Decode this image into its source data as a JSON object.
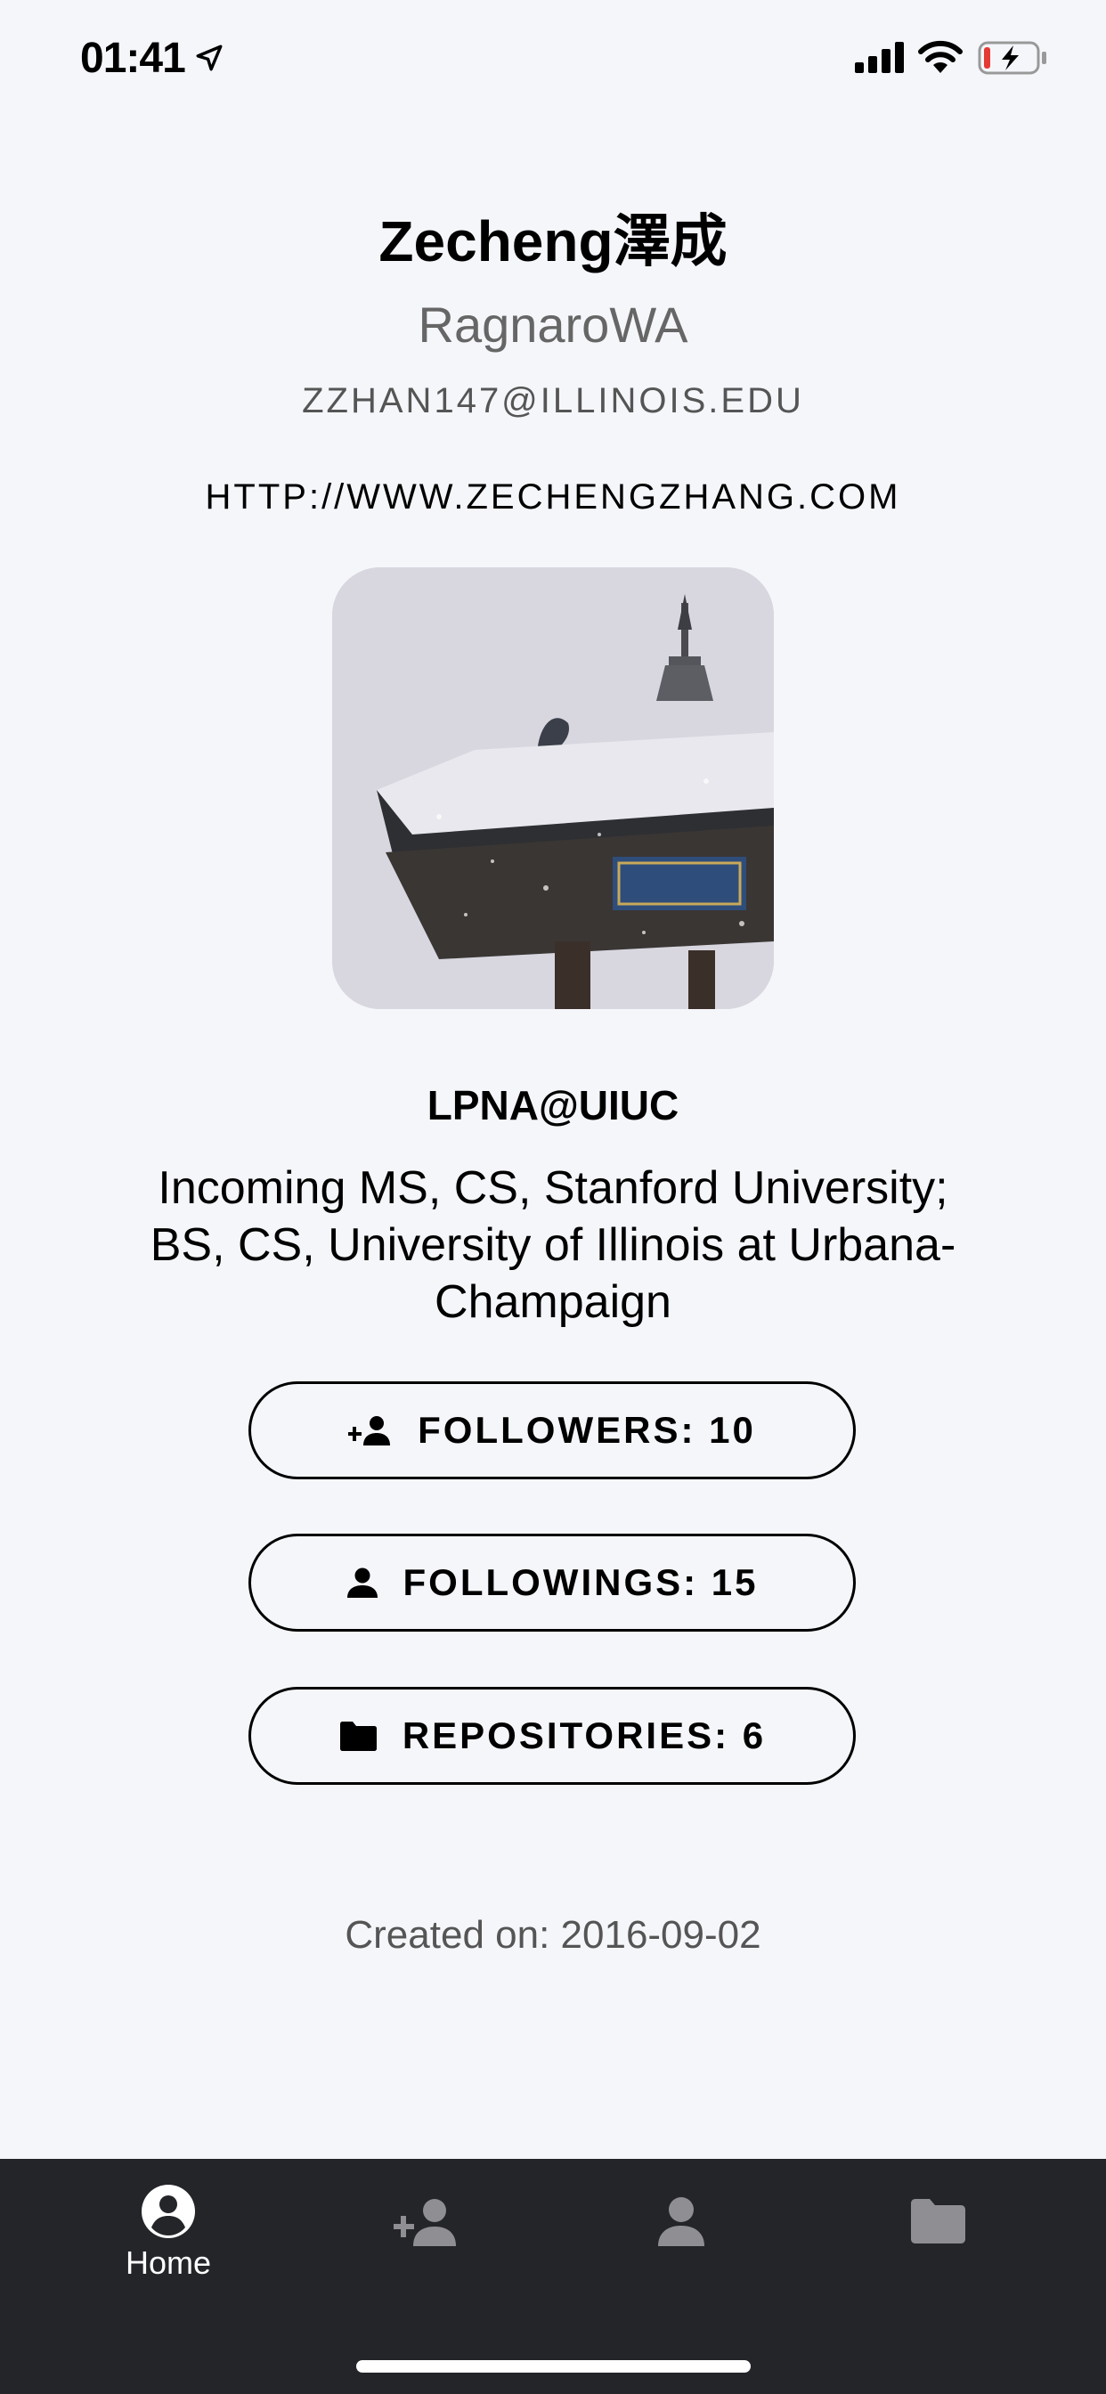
{
  "status_bar": {
    "time": "01:41"
  },
  "profile": {
    "name": "Zecheng澤成",
    "login": "RagnaroWA",
    "email": "ZZHAN147@ILLINOIS.EDU",
    "website": "HTTP://WWW.ZECHENGZHANG.COM",
    "company": "LPNA@UIUC",
    "bio": "Incoming MS, CS, Stanford University; BS, CS, University of Illinois at Urbana-Champaign",
    "created": "Created on: 2016-09-02"
  },
  "stats": {
    "followers_label": "FOLLOWERS: 10",
    "followings_label": "FOLLOWINGS: 15",
    "repositories_label": "REPOSITORIES: 6"
  },
  "tabs": [
    {
      "label": "Home",
      "icon": "account-circle-icon",
      "active": true
    },
    {
      "label": "",
      "icon": "person-add-icon",
      "active": false
    },
    {
      "label": "",
      "icon": "person-icon",
      "active": false
    },
    {
      "label": "",
      "icon": "folder-icon",
      "active": false
    }
  ],
  "colors": {
    "background": "#f5f6fa",
    "tab_bar": "#232529",
    "tab_active": "#ffffff",
    "tab_inactive": "#8e8e93",
    "text_secondary": "#666666",
    "battery_low": "#e53935"
  }
}
